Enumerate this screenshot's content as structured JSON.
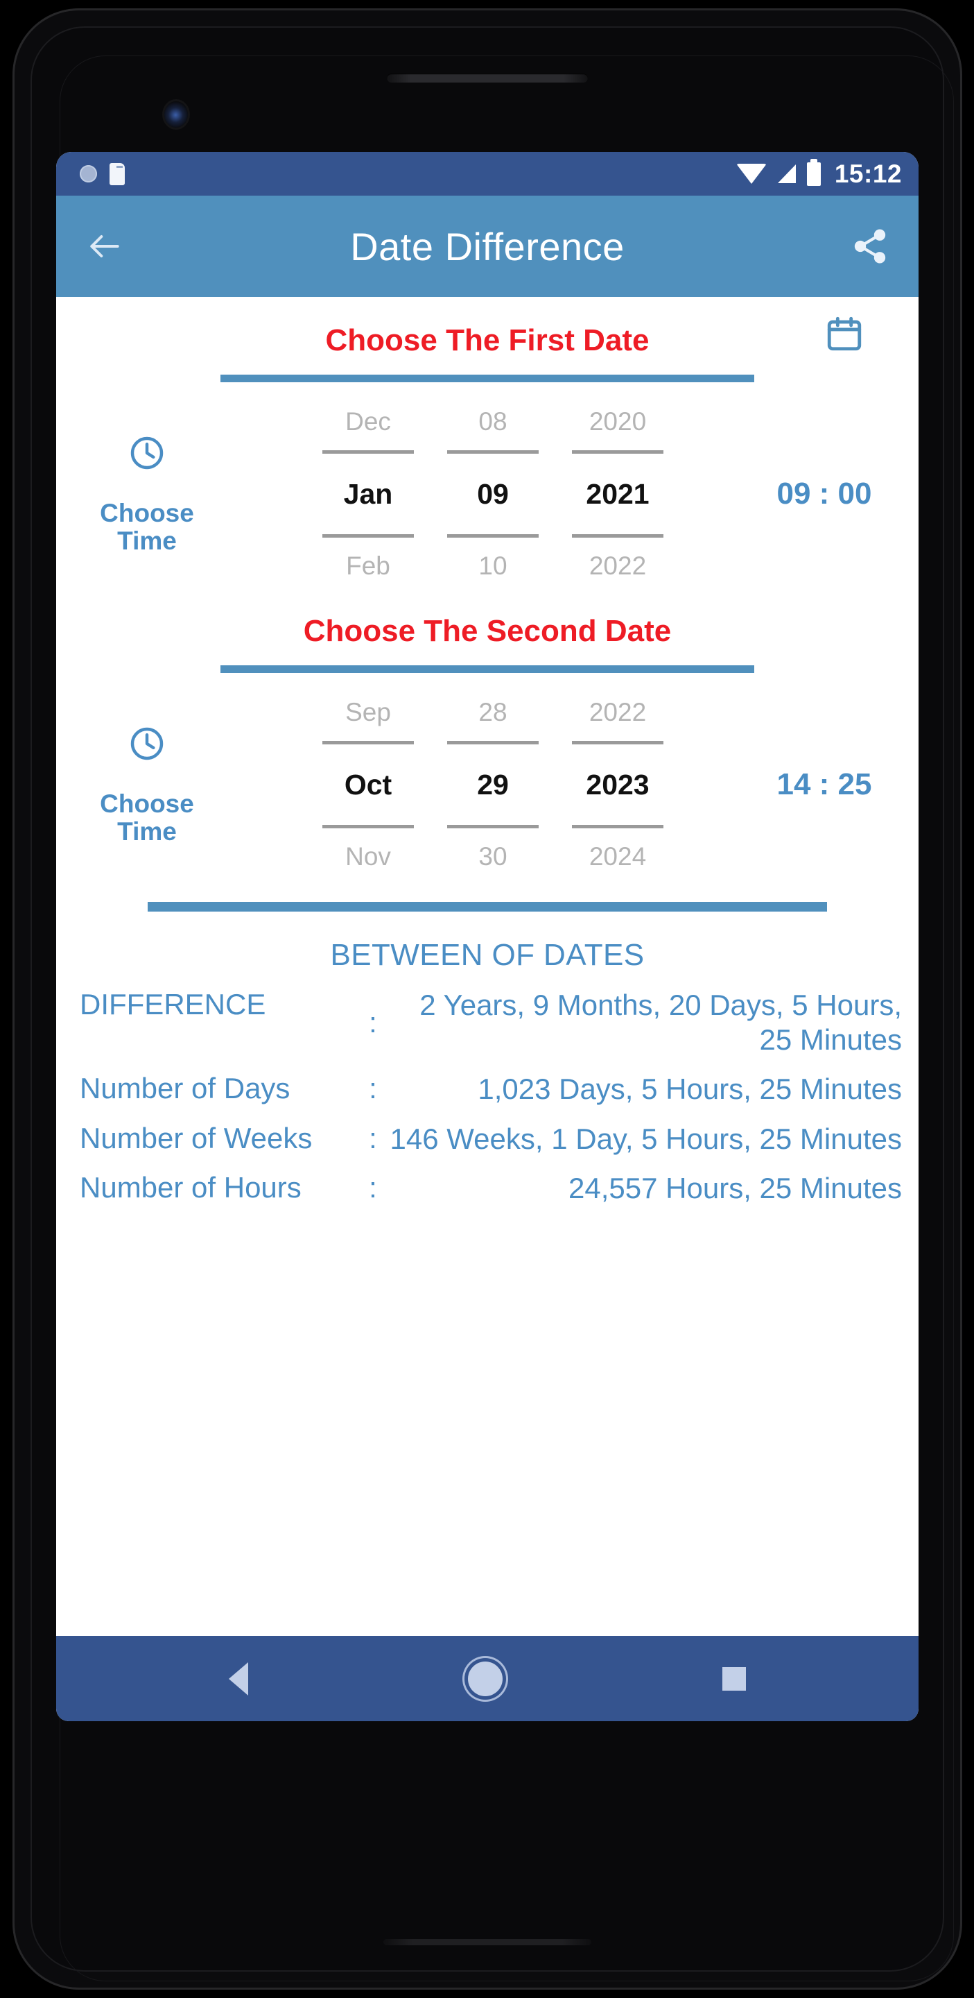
{
  "status_bar": {
    "icons_left": [
      "notification-circle-icon",
      "sd-card-icon"
    ],
    "icons_right": [
      "wifi-icon",
      "signal-icon",
      "battery-icon"
    ],
    "time": "15:12",
    "background_color": "#35548F"
  },
  "app_bar": {
    "back_icon": "back-arrow-icon",
    "title": "Date Difference",
    "share_icon": "share-icon",
    "background_color": "#5090BD",
    "title_color": "#FFFFFF"
  },
  "first_date": {
    "section_title": "Choose The First Date",
    "title_color": "#EE1C25",
    "calendar_icon": "calendar-icon",
    "clock_icon": "clock-icon",
    "choose_time_label": "Choose\nTime",
    "choose_time_line1": "Choose",
    "choose_time_line2": "Time",
    "month": {
      "prev": "Dec",
      "selected": "Jan",
      "next": "Feb"
    },
    "day": {
      "prev": "08",
      "selected": "09",
      "next": "10"
    },
    "year": {
      "prev": "2020",
      "selected": "2021",
      "next": "2022"
    },
    "time_value": "09 : 00"
  },
  "second_date": {
    "section_title": "Choose The Second Date",
    "title_color": "#EE1C25",
    "clock_icon": "clock-icon",
    "choose_time_line1": "Choose",
    "choose_time_line2": "Time",
    "month": {
      "prev": "Sep",
      "selected": "Oct",
      "next": "Nov"
    },
    "day": {
      "prev": "28",
      "selected": "29",
      "next": "30"
    },
    "year": {
      "prev": "2022",
      "selected": "2023",
      "next": "2024"
    },
    "time_value": "14 : 25"
  },
  "results": {
    "heading": "BETWEEN OF DATES",
    "text_color": "#4A8DC4",
    "rows": [
      {
        "label": "DIFFERENCE",
        "colon": ":",
        "value": "2 Years, 9 Months, 20 Days, 5 Hours, 25 Minutes"
      },
      {
        "label": "Number of Days",
        "colon": ":",
        "value": "1,023 Days, 5 Hours, 25 Minutes"
      },
      {
        "label": "Number of Weeks",
        "colon": ":",
        "value": "146 Weeks, 1 Day, 5 Hours, 25 Minutes"
      },
      {
        "label": "Number of Hours",
        "colon": ":",
        "value": "24,557 Hours, 25 Minutes"
      }
    ]
  },
  "nav_bar": {
    "back_icon": "nav-back-triangle-icon",
    "home_icon": "nav-home-circle-icon",
    "recent_icon": "nav-recent-square-icon",
    "background_color": "#35548F"
  }
}
